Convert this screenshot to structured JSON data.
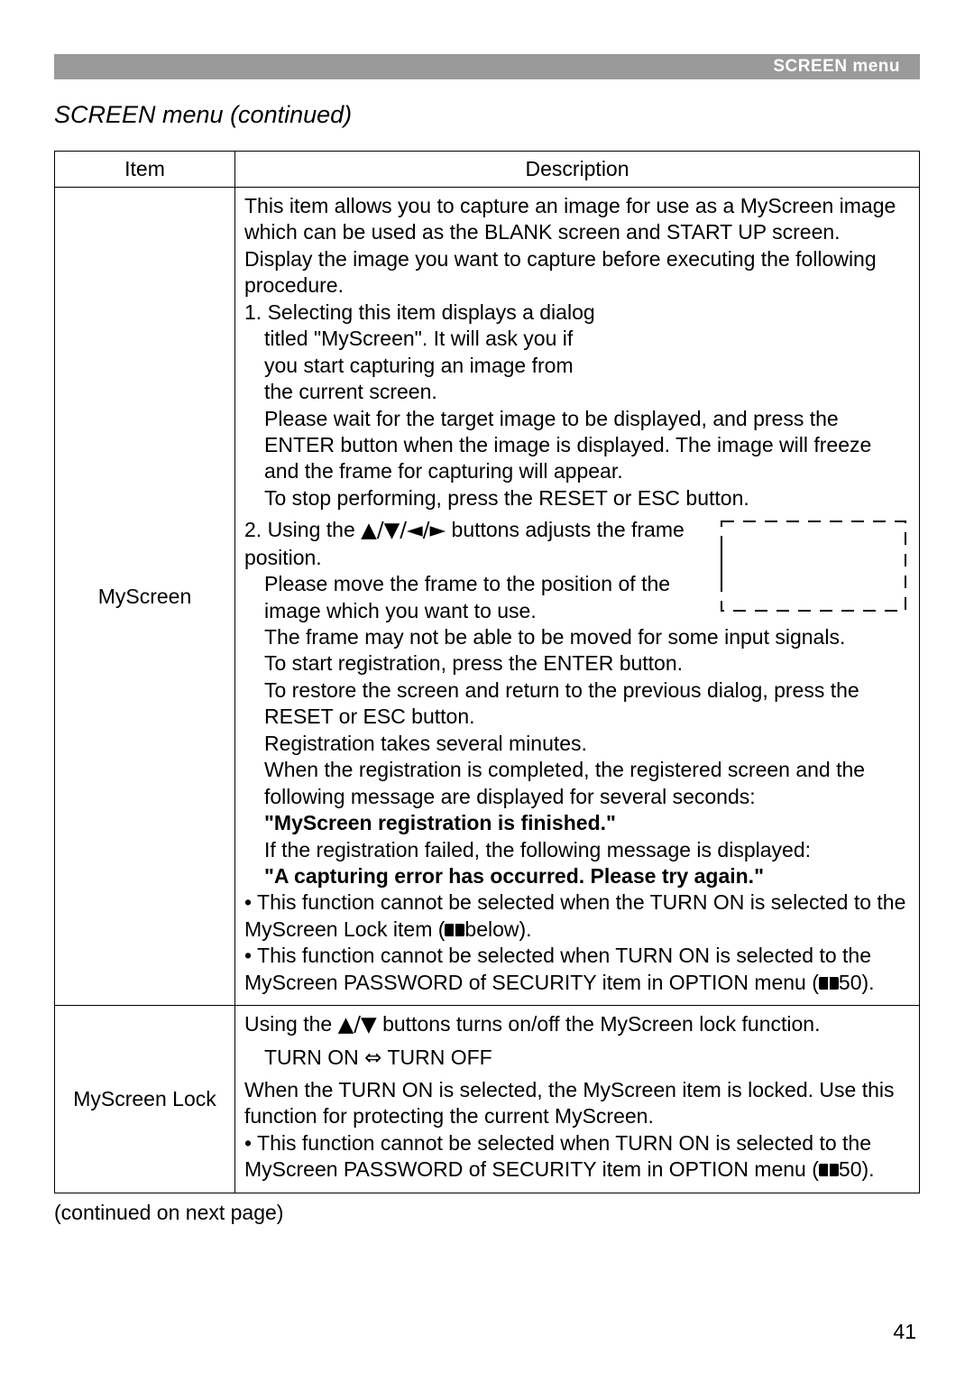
{
  "header": {
    "label": "SCREEN menu"
  },
  "section_title": "SCREEN menu (continued)",
  "table": {
    "head": {
      "item": "Item",
      "desc": "Description"
    },
    "rows": [
      {
        "item": "MyScreen",
        "intro": "This item allows you to capture an image for use as a MyScreen image which can be used as the BLANK screen and START UP screen. Display the image you want to capture before executing the following procedure.",
        "step1_line1": "1. Selecting this item displays a dialog",
        "step1_line2": "titled \"MyScreen\". It will ask you if",
        "step1_line3": "you start capturing an image from",
        "step1_line4": "the current screen.",
        "step1_line5": "Please wait for the target image to be displayed, and press the ENTER button when the image is displayed. The image will freeze and the frame for capturing will appear.",
        "step1_line6": "To stop performing, press the RESET or ESC button.",
        "step2_lead": "2. Using the ",
        "arrows4": "▲/▼/◄/►",
        "step2_tail": " buttons adjusts the frame position.",
        "step2_line2": "Please move the frame to the position of the image which you want to use.",
        "step2_line3": "The frame may not be able to be moved for some input signals.",
        "step2_line4": "To start registration, press the ENTER button.",
        "step2_line5": "To restore the screen and return to the previous dialog, press the RESET or ESC button.",
        "step2_line6": "Registration takes several minutes.",
        "reg_done1": "When the registration is completed, the registered screen and the following message are displayed for several seconds:",
        "reg_done_msg": "\"MyScreen registration is finished.\"",
        "reg_fail1": "If the registration failed, the following message is displayed:",
        "reg_fail_msg": "\"A capturing error has occurred. Please try again.\"",
        "bullet1a": "• This function cannot be selected when the TURN ON is selected to the MyScreen Lock item (",
        "bullet1b": "below).",
        "bullet2a": "• This function cannot be selected when TURN ON is selected to the MyScreen PASSWORD of SECURITY item in OPTION menu (",
        "bullet2b": "50)."
      },
      {
        "item": "MyScreen Lock",
        "line1a": "Using the ",
        "arrows2": "▲/▼",
        "line1b": " buttons turns on/off the MyScreen lock function.",
        "toggle_a": "TURN ON ",
        "toggle_arrow": "⇔",
        "toggle_b": " TURN OFF",
        "line3": "When the TURN ON is selected, the MyScreen item is locked. Use this function for protecting the current MyScreen.",
        "bullet_a": "• This function cannot be selected when TURN ON is selected to the MyScreen PASSWORD of SECURITY item in OPTION menu (",
        "bullet_b": "50)."
      }
    ]
  },
  "continued": "(continued on next page)",
  "page_number": "41"
}
